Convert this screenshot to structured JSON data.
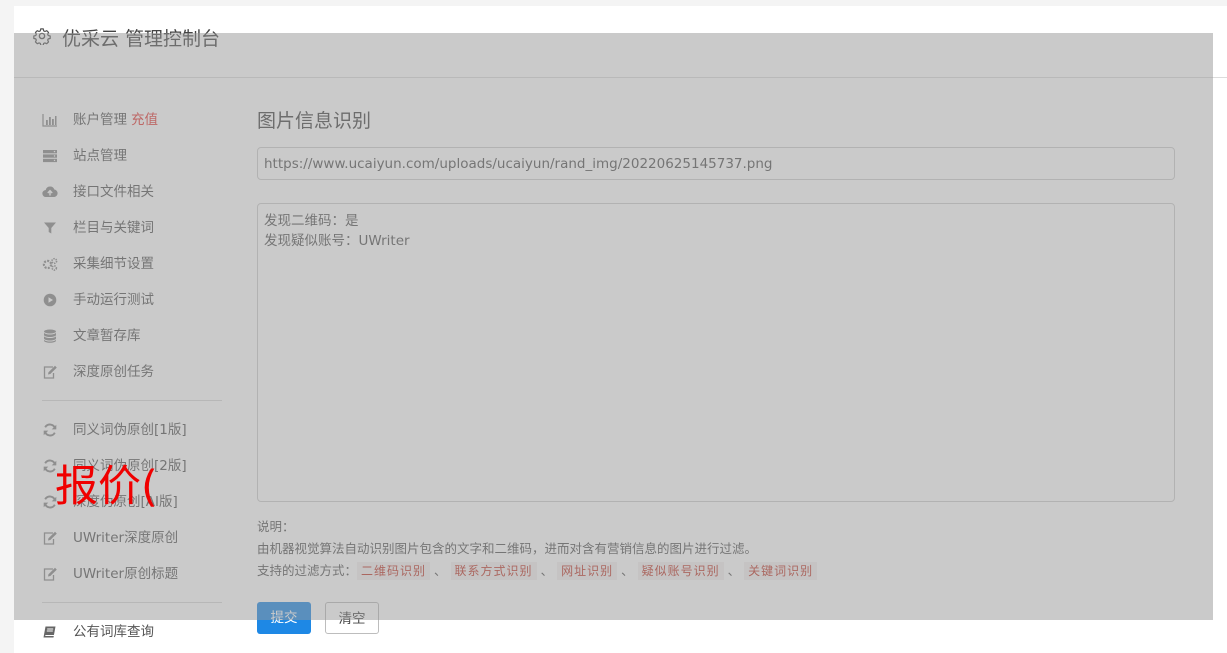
{
  "header": {
    "title": "优采云 管理控制台"
  },
  "sidebar": {
    "groups": [
      {
        "items": [
          {
            "label": "账户管理",
            "extra": "充值",
            "icon": "bar-chart-icon"
          },
          {
            "label": "站点管理",
            "icon": "server-icon"
          },
          {
            "label": "接口文件相关",
            "icon": "cloud-upload-icon"
          },
          {
            "label": "栏目与关键词",
            "icon": "filter-icon"
          },
          {
            "label": "采集细节设置",
            "icon": "gears-icon"
          },
          {
            "label": "手动运行测试",
            "icon": "play-circle-icon"
          },
          {
            "label": "文章暂存库",
            "icon": "database-icon"
          },
          {
            "label": "深度原创任务",
            "icon": "edit-icon"
          }
        ]
      },
      {
        "items": [
          {
            "label": "同义词伪原创[1版]",
            "icon": "refresh-icon"
          },
          {
            "label": "同义词伪原创[2版]",
            "icon": "refresh-icon"
          },
          {
            "label": "深度伪原创[AI版]",
            "icon": "refresh-icon"
          },
          {
            "label": "UWriter深度原创",
            "icon": "edit-icon"
          },
          {
            "label": "UWriter原创标题",
            "icon": "edit-icon"
          }
        ]
      },
      {
        "items": [
          {
            "label": "公有词库查询",
            "icon": "book-icon"
          }
        ]
      }
    ]
  },
  "main": {
    "title": "图片信息识别",
    "url_value": "https://www.ucaiyun.com/uploads/ucaiyun/rand_img/20220625145737.png",
    "result_lines": [
      "发现二维码：是",
      "发现疑似账号：UWriter"
    ],
    "note_title": "说明：",
    "note_desc": "由机器视觉算法自动识别图片包含的文字和二维码，进而对含有营销信息的图片进行过滤。",
    "filter_label": "支持的过滤方式：",
    "filters": [
      "二维码识别",
      "联系方式识别",
      "网址识别",
      "疑似账号识别",
      "关键词识别"
    ],
    "submit_label": "提交",
    "clear_label": "清空"
  },
  "stamp_text": "报价(",
  "colors": {
    "accent": "#1e88e5",
    "recharge": "#e53935",
    "tag_text": "#c0392b",
    "stamp": "#f00000"
  }
}
